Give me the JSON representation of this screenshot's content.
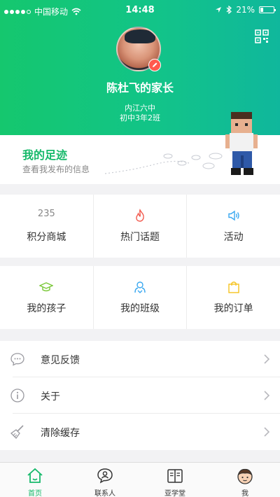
{
  "status_bar": {
    "carrier": "中国移动",
    "time": "14:48",
    "battery": "21%",
    "battery_level": 0.21
  },
  "profile": {
    "name": "陈杜飞的家长",
    "school": "内江六中",
    "class": "初中3年2班"
  },
  "footprint": {
    "title": "我的足迹",
    "subtitle": "查看我发布的信息"
  },
  "grid1": [
    {
      "number": "235",
      "label": "积分商城"
    },
    {
      "label": "热门话题",
      "icon": "flame-icon"
    },
    {
      "label": "活动",
      "icon": "speaker-icon"
    }
  ],
  "grid2": [
    {
      "label": "我的孩子",
      "icon": "graduation-cap-icon"
    },
    {
      "label": "我的班级",
      "icon": "class-group-icon"
    },
    {
      "label": "我的订单",
      "icon": "shopping-bag-icon"
    }
  ],
  "list": [
    {
      "label": "意见反馈",
      "icon": "chat-bubble-icon"
    },
    {
      "label": "关于",
      "icon": "info-icon"
    },
    {
      "label": "清除缓存",
      "icon": "broom-icon"
    }
  ],
  "tabs": [
    {
      "label": "首页",
      "icon": "home-icon",
      "active": true
    },
    {
      "label": "联系人",
      "icon": "contacts-icon"
    },
    {
      "label": "亚学堂",
      "icon": "book-icon"
    },
    {
      "label": "我",
      "icon": "me-avatar-icon"
    }
  ],
  "colors": {
    "accent": "#16b96a",
    "flame": "#f25a4e",
    "speaker": "#3aa8f0",
    "cap": "#7bc83a",
    "class_icon": "#3aa8f0",
    "bag": "#f5c320"
  }
}
